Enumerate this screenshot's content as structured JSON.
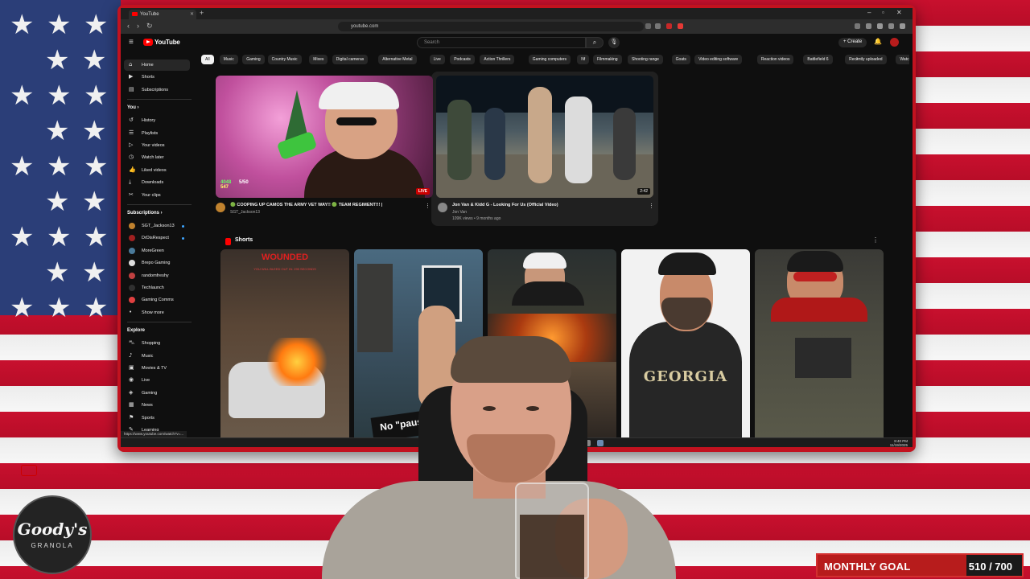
{
  "browser": {
    "tab_title": "YouTube",
    "url": "youtube.com",
    "status_url": "https://www.youtube.com/watch?v=..."
  },
  "youtube": {
    "logo_text": "YouTube",
    "search_placeholder": "Search",
    "create_label": "+ Create"
  },
  "sidebar": {
    "main": [
      {
        "label": "Home",
        "icon": "home-icon"
      },
      {
        "label": "Shorts",
        "icon": "shorts-icon"
      },
      {
        "label": "Subscriptions",
        "icon": "subscriptions-icon"
      }
    ],
    "you_heading": "You  ›",
    "you": [
      {
        "label": "History",
        "icon": "history-icon"
      },
      {
        "label": "Playlists",
        "icon": "playlists-icon"
      },
      {
        "label": "Your videos",
        "icon": "your-videos-icon"
      },
      {
        "label": "Watch later",
        "icon": "watch-later-icon"
      },
      {
        "label": "Liked videos",
        "icon": "liked-icon"
      },
      {
        "label": "Downloads",
        "icon": "download-icon"
      },
      {
        "label": "Your clips",
        "icon": "clips-icon"
      }
    ],
    "subs_heading": "Subscriptions  ›",
    "subs": [
      {
        "label": "SGT_Jackson13",
        "color": "#c0822e"
      },
      {
        "label": "DrDisRespect",
        "color": "#a02020"
      },
      {
        "label": "MoreGreen",
        "color": "#4a7a9a"
      },
      {
        "label": "Brepo Gaming",
        "color": "#dddddd"
      },
      {
        "label": "randomfreshy",
        "color": "#c04040"
      },
      {
        "label": "Techlaunch",
        "color": "#303030"
      },
      {
        "label": "Gaming Comms",
        "color": "#e04040"
      }
    ],
    "show_more": "Show more",
    "explore_heading": "Explore",
    "explore": [
      {
        "label": "Shopping",
        "icon": "shopping-icon"
      },
      {
        "label": "Music",
        "icon": "music-icon"
      },
      {
        "label": "Movies & TV",
        "icon": "movies-icon"
      },
      {
        "label": "Live",
        "icon": "live-icon"
      },
      {
        "label": "Gaming",
        "icon": "gaming-icon"
      },
      {
        "label": "News",
        "icon": "news-icon"
      },
      {
        "label": "Sports",
        "icon": "sports-icon"
      },
      {
        "label": "Learning",
        "icon": "learning-icon"
      }
    ]
  },
  "chips": [
    "All",
    "Music",
    "Gaming",
    "Country Music",
    "Mixes",
    "Digital cameras",
    "Alternative Metal",
    "Live",
    "Podcasts",
    "Action Thrillers",
    "Gaming computers",
    "Nf",
    "Filmmaking",
    "Shooting range",
    "Goats",
    "Video editing software",
    "Reaction videos",
    "Battlefield 6",
    "Recently uploaded",
    "Watched"
  ],
  "videos": [
    {
      "title": "🟢 COOPING UP CAMOS THE ARMY VET WAY!! 🟢 TEAM REGIMENT!!! |",
      "channel": "SGT_Jackson13",
      "badge": "LIVE",
      "overlay_left": "4048",
      "overlay_right": "5/50",
      "overlay_left2": "547"
    },
    {
      "title": "Jon Van & Kidd G - Looking For Us (Official Video)",
      "channel": "Jon Van",
      "meta": "109K views • 9 months ago",
      "badge": "2:42"
    }
  ],
  "shorts": {
    "heading": "Shorts",
    "items": [
      {
        "overlay": "WOUNDED",
        "sub": "YOU WILL BLEED OUT IN: 295 SECONDS"
      },
      {
        "overlay": "No \"pause c"
      },
      {
        "overlay": ""
      },
      {
        "overlay": "GEORGIA"
      },
      {
        "overlay": ""
      }
    ]
  },
  "taskbar": {
    "time": "8:40 PM",
    "date": "11/19/2025"
  },
  "brand": {
    "name": "Goody's",
    "sub": "GRANOLA"
  },
  "goal": {
    "label": "MONTHLY GOAL",
    "current": 510,
    "target": 700,
    "text": "510 / 700"
  }
}
